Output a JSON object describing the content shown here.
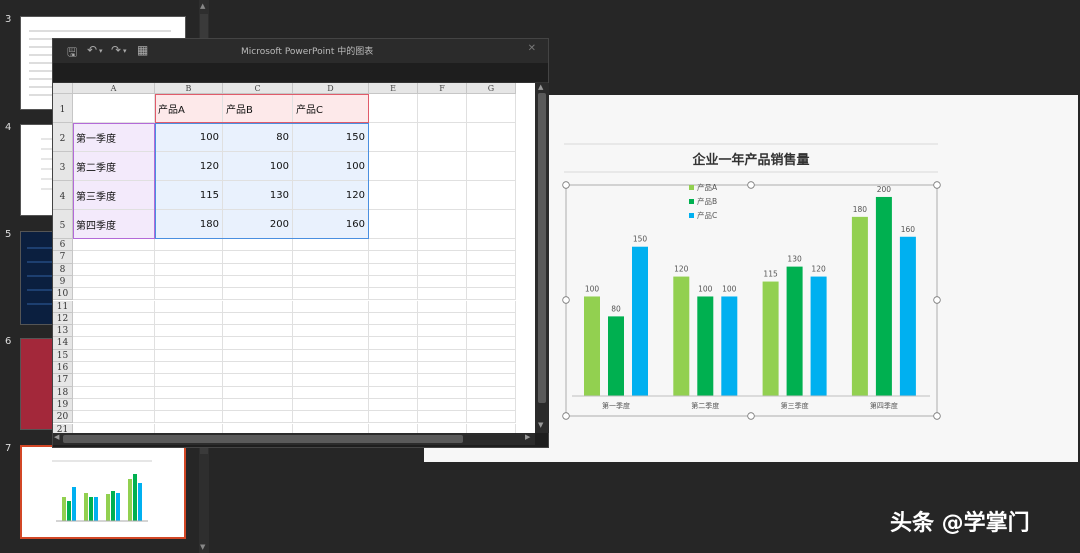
{
  "thumbnails": [
    {
      "number": "3"
    },
    {
      "number": "4"
    },
    {
      "number": "5"
    },
    {
      "number": "6"
    },
    {
      "number": "7",
      "selected": true
    }
  ],
  "excel": {
    "title": "Microsoft PowerPoint 中的图表",
    "columns": [
      "A",
      "B",
      "C",
      "D",
      "E",
      "F",
      "G"
    ],
    "rows": [
      "1",
      "2",
      "3",
      "4",
      "5",
      "6",
      "7",
      "8",
      "9",
      "10",
      "11",
      "12",
      "13",
      "14",
      "15",
      "16",
      "17",
      "18",
      "19",
      "20",
      "21"
    ],
    "headers": [
      "产品A",
      "产品B",
      "产品C"
    ],
    "data": [
      {
        "label": "第一季度",
        "values": [
          "100",
          "80",
          "150"
        ]
      },
      {
        "label": "第二季度",
        "values": [
          "120",
          "100",
          "100"
        ]
      },
      {
        "label": "第三季度",
        "values": [
          "115",
          "130",
          "120"
        ]
      },
      {
        "label": "第四季度",
        "values": [
          "180",
          "200",
          "160"
        ]
      }
    ]
  },
  "chart_data": {
    "type": "bar",
    "title": "企业一年产品销售量",
    "categories": [
      "第一季度",
      "第二季度",
      "第三季度",
      "第四季度"
    ],
    "series": [
      {
        "name": "产品A",
        "values": [
          100,
          120,
          115,
          180
        ],
        "color": "#92d050"
      },
      {
        "name": "产品B",
        "values": [
          80,
          100,
          130,
          200
        ],
        "color": "#00b050"
      },
      {
        "name": "产品C",
        "values": [
          150,
          100,
          120,
          160
        ],
        "color": "#00b0f0"
      }
    ],
    "ylim": [
      0,
      210
    ],
    "legend": "top-left",
    "grid": false
  },
  "watermark": "头条 @学掌门"
}
